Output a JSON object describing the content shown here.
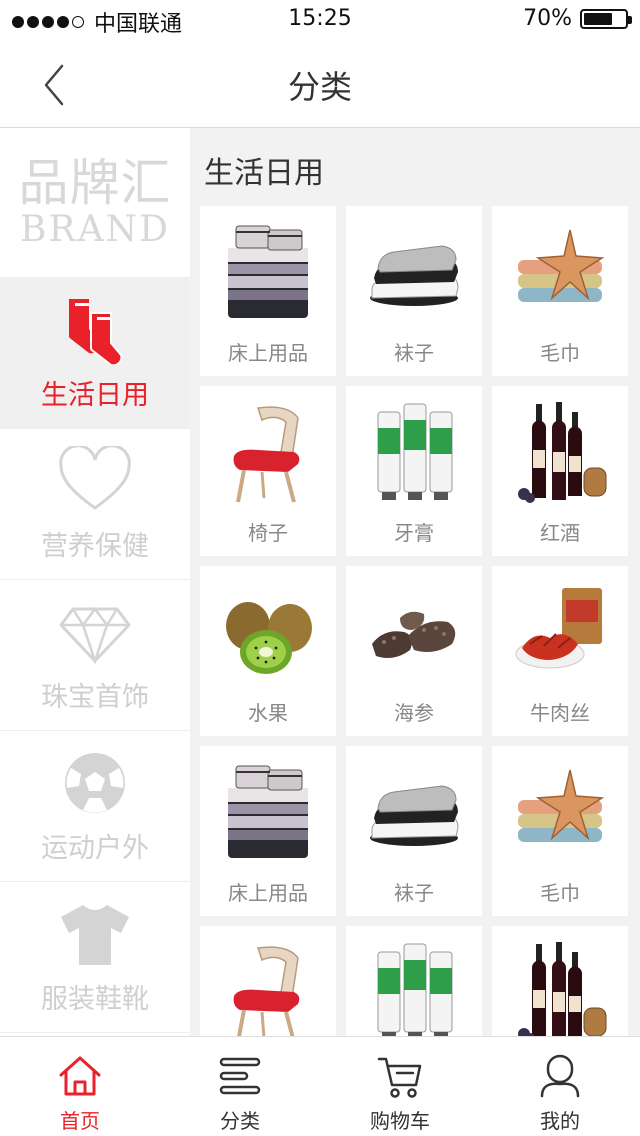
{
  "status_bar": {
    "carrier": "中国联通",
    "time": "15:25",
    "battery_percent": "70%",
    "battery_level": 0.7
  },
  "nav": {
    "title": "分类",
    "back_icon": "chevron-left-icon"
  },
  "sidebar": {
    "brand_cn": "品牌汇",
    "brand_en": "BRAND",
    "items": [
      {
        "label": "生活日用",
        "icon": "socks-icon",
        "active": true
      },
      {
        "label": "营养保健",
        "icon": "heart-icon",
        "active": false
      },
      {
        "label": "珠宝首饰",
        "icon": "diamond-icon",
        "active": false
      },
      {
        "label": "运动户外",
        "icon": "soccer-ball-icon",
        "active": false
      },
      {
        "label": "服装鞋靴",
        "icon": "tshirt-icon",
        "active": false
      }
    ]
  },
  "content": {
    "section_title": "生活日用",
    "products": [
      {
        "label": "床上用品",
        "icon": "bedding-image"
      },
      {
        "label": "袜子",
        "icon": "socks-image"
      },
      {
        "label": "毛巾",
        "icon": "towel-image"
      },
      {
        "label": "椅子",
        "icon": "chair-image"
      },
      {
        "label": "牙膏",
        "icon": "toothpaste-image"
      },
      {
        "label": "红酒",
        "icon": "wine-image"
      },
      {
        "label": "水果",
        "icon": "kiwi-image"
      },
      {
        "label": "海参",
        "icon": "sea-cucumber-image"
      },
      {
        "label": "牛肉丝",
        "icon": "beef-jerky-image"
      },
      {
        "label": "床上用品",
        "icon": "bedding-image"
      },
      {
        "label": "袜子",
        "icon": "socks-image"
      },
      {
        "label": "毛巾",
        "icon": "towel-image"
      },
      {
        "label": "",
        "icon": "chair-image"
      },
      {
        "label": "",
        "icon": "toothpaste-image"
      },
      {
        "label": "",
        "icon": "wine-image"
      }
    ]
  },
  "tab_bar": {
    "tabs": [
      {
        "label": "首页",
        "icon": "home-icon",
        "active": true
      },
      {
        "label": "分类",
        "icon": "category-icon",
        "active": false
      },
      {
        "label": "购物车",
        "icon": "cart-icon",
        "active": false
      },
      {
        "label": "我的",
        "icon": "user-icon",
        "active": false
      }
    ]
  },
  "colors": {
    "accent": "#e8212b",
    "inactive_icon": "#d4d4d4",
    "background": "#f2f2f2"
  }
}
